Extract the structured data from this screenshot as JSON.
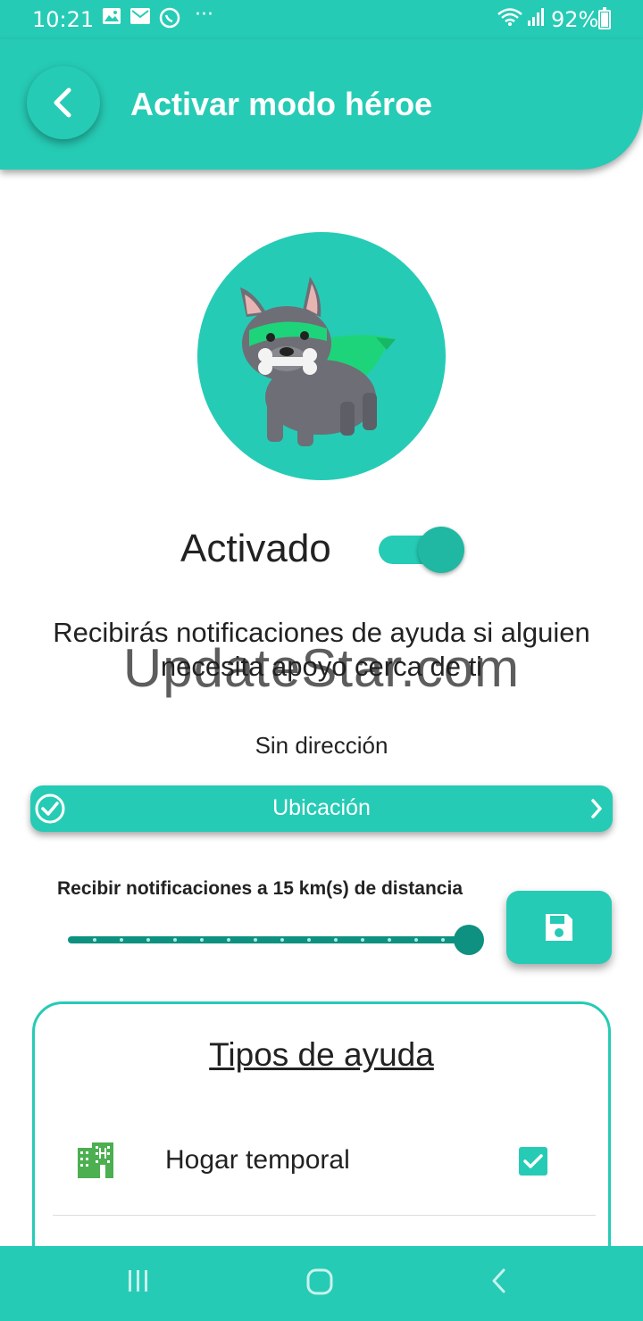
{
  "status_bar": {
    "time": "10:21",
    "battery": "92%",
    "more_indicator": "···",
    "icons": [
      "image-icon",
      "mail-icon",
      "whatsapp-icon",
      "wifi-icon",
      "signal-icon",
      "battery-icon"
    ]
  },
  "header": {
    "title": "Activar modo héroe",
    "back_icon": "chevron-left-icon"
  },
  "hero": {
    "image": "hero-dog-illustration",
    "status_label": "Activado",
    "toggle_on": true
  },
  "info_text": "Recibirás notificaciones de ayuda si alguien necesita apoyo cerca de ti",
  "watermark": "UpdateStar.com",
  "address": {
    "label": "Sin dirección",
    "button_label": "Ubicación",
    "button_icons": [
      "check-circle-icon",
      "chevron-right-icon"
    ]
  },
  "distance": {
    "label": "Recibir notificaciones a 15 km(s) de distancia",
    "value_km": 15,
    "slider_fraction": 1.0
  },
  "save_button": {
    "icon": "floppy-disk-icon"
  },
  "help_types": {
    "title": "Tipos de ayuda",
    "items": [
      {
        "label": "Hogar temporal",
        "icon": "building-icon",
        "checked": true
      }
    ]
  },
  "nav_bar": {
    "icons": [
      "recent-apps-icon",
      "home-icon",
      "back-icon"
    ]
  },
  "colors": {
    "primary": "#26cbb5",
    "primary_dark": "#0e9180",
    "text": "#222222",
    "icon_green": "#4caf50"
  }
}
